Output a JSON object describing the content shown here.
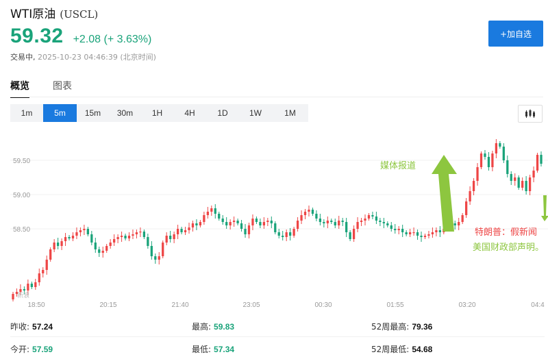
{
  "header": {
    "title": "WTI原油",
    "code": "(USCL)",
    "price": "59.32",
    "change": "+2.08 (+ 3.63%)",
    "status": "交易中,",
    "timestamp": "2025-10-23 04:46:39",
    "timezone": "(北京时间)",
    "add_watchlist_label": "+加自选"
  },
  "tabs": [
    {
      "label": "概览",
      "active": true
    },
    {
      "label": "图表",
      "active": false
    }
  ],
  "intervals": [
    {
      "label": "1m",
      "active": false
    },
    {
      "label": "5m",
      "active": true
    },
    {
      "label": "15m",
      "active": false
    },
    {
      "label": "30m",
      "active": false
    },
    {
      "label": "1H",
      "active": false
    },
    {
      "label": "4H",
      "active": false
    },
    {
      "label": "1D",
      "active": false
    },
    {
      "label": "1W",
      "active": false
    },
    {
      "label": "1M",
      "active": false
    }
  ],
  "icons": {
    "chart_type": "candlestick-icon"
  },
  "colors": {
    "up": "#ee4646",
    "down": "#1aa37a",
    "accent": "#1a7adf",
    "annotation_green": "#8dc63f"
  },
  "chart_data": {
    "type": "candlestick",
    "x_ticks": [
      "18:50",
      "20:15",
      "21:40",
      "23:05",
      "00:30",
      "01:55",
      "03:20",
      "04:4"
    ],
    "y_ticks": [
      59.5,
      59.0,
      58.5
    ],
    "ylim": [
      57.5,
      59.9
    ],
    "annotations": [
      {
        "text": "媒体报道",
        "color": "#8dc63f"
      },
      {
        "text": "特朗普：假新闻",
        "color": "#ee4646"
      },
      {
        "text": "美国财政部声明。",
        "color": "#8dc63f"
      }
    ],
    "watermark": "新浪"
  },
  "stats": [
    {
      "label": "昨收:",
      "value": "57.24",
      "tone": "d"
    },
    {
      "label": "最高:",
      "value": "59.83",
      "tone": "g"
    },
    {
      "label": "52周最高:",
      "value": "79.36",
      "tone": "d"
    },
    {
      "label": "今开:",
      "value": "57.59",
      "tone": "g"
    },
    {
      "label": "最低:",
      "value": "57.34",
      "tone": "g"
    },
    {
      "label": "52周最低:",
      "value": "54.68",
      "tone": "d"
    }
  ]
}
